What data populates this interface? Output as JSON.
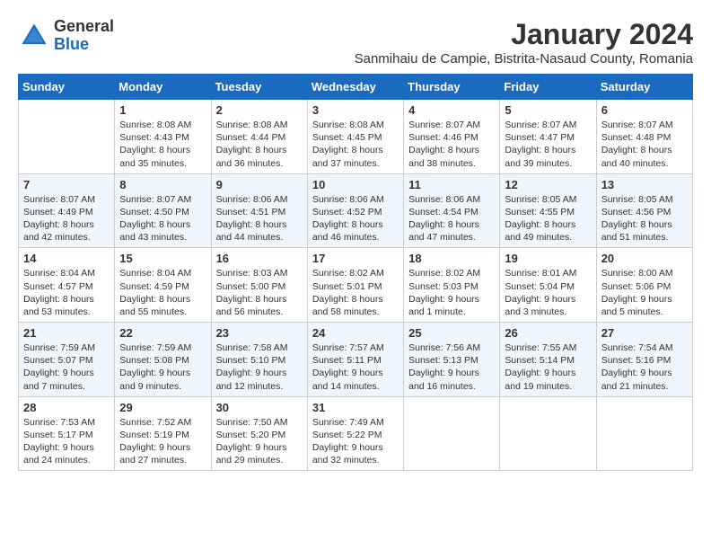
{
  "logo": {
    "general": "General",
    "blue": "Blue"
  },
  "title": "January 2024",
  "subtitle": "Sanmihaiu de Campie, Bistrita-Nasaud County, Romania",
  "days_of_week": [
    "Sunday",
    "Monday",
    "Tuesday",
    "Wednesday",
    "Thursday",
    "Friday",
    "Saturday"
  ],
  "weeks": [
    [
      {
        "day": "",
        "info": ""
      },
      {
        "day": "1",
        "info": "Sunrise: 8:08 AM\nSunset: 4:43 PM\nDaylight: 8 hours\nand 35 minutes."
      },
      {
        "day": "2",
        "info": "Sunrise: 8:08 AM\nSunset: 4:44 PM\nDaylight: 8 hours\nand 36 minutes."
      },
      {
        "day": "3",
        "info": "Sunrise: 8:08 AM\nSunset: 4:45 PM\nDaylight: 8 hours\nand 37 minutes."
      },
      {
        "day": "4",
        "info": "Sunrise: 8:07 AM\nSunset: 4:46 PM\nDaylight: 8 hours\nand 38 minutes."
      },
      {
        "day": "5",
        "info": "Sunrise: 8:07 AM\nSunset: 4:47 PM\nDaylight: 8 hours\nand 39 minutes."
      },
      {
        "day": "6",
        "info": "Sunrise: 8:07 AM\nSunset: 4:48 PM\nDaylight: 8 hours\nand 40 minutes."
      }
    ],
    [
      {
        "day": "7",
        "info": "Sunrise: 8:07 AM\nSunset: 4:49 PM\nDaylight: 8 hours\nand 42 minutes."
      },
      {
        "day": "8",
        "info": "Sunrise: 8:07 AM\nSunset: 4:50 PM\nDaylight: 8 hours\nand 43 minutes."
      },
      {
        "day": "9",
        "info": "Sunrise: 8:06 AM\nSunset: 4:51 PM\nDaylight: 8 hours\nand 44 minutes."
      },
      {
        "day": "10",
        "info": "Sunrise: 8:06 AM\nSunset: 4:52 PM\nDaylight: 8 hours\nand 46 minutes."
      },
      {
        "day": "11",
        "info": "Sunrise: 8:06 AM\nSunset: 4:54 PM\nDaylight: 8 hours\nand 47 minutes."
      },
      {
        "day": "12",
        "info": "Sunrise: 8:05 AM\nSunset: 4:55 PM\nDaylight: 8 hours\nand 49 minutes."
      },
      {
        "day": "13",
        "info": "Sunrise: 8:05 AM\nSunset: 4:56 PM\nDaylight: 8 hours\nand 51 minutes."
      }
    ],
    [
      {
        "day": "14",
        "info": "Sunrise: 8:04 AM\nSunset: 4:57 PM\nDaylight: 8 hours\nand 53 minutes."
      },
      {
        "day": "15",
        "info": "Sunrise: 8:04 AM\nSunset: 4:59 PM\nDaylight: 8 hours\nand 55 minutes."
      },
      {
        "day": "16",
        "info": "Sunrise: 8:03 AM\nSunset: 5:00 PM\nDaylight: 8 hours\nand 56 minutes."
      },
      {
        "day": "17",
        "info": "Sunrise: 8:02 AM\nSunset: 5:01 PM\nDaylight: 8 hours\nand 58 minutes."
      },
      {
        "day": "18",
        "info": "Sunrise: 8:02 AM\nSunset: 5:03 PM\nDaylight: 9 hours\nand 1 minute."
      },
      {
        "day": "19",
        "info": "Sunrise: 8:01 AM\nSunset: 5:04 PM\nDaylight: 9 hours\nand 3 minutes."
      },
      {
        "day": "20",
        "info": "Sunrise: 8:00 AM\nSunset: 5:06 PM\nDaylight: 9 hours\nand 5 minutes."
      }
    ],
    [
      {
        "day": "21",
        "info": "Sunrise: 7:59 AM\nSunset: 5:07 PM\nDaylight: 9 hours\nand 7 minutes."
      },
      {
        "day": "22",
        "info": "Sunrise: 7:59 AM\nSunset: 5:08 PM\nDaylight: 9 hours\nand 9 minutes."
      },
      {
        "day": "23",
        "info": "Sunrise: 7:58 AM\nSunset: 5:10 PM\nDaylight: 9 hours\nand 12 minutes."
      },
      {
        "day": "24",
        "info": "Sunrise: 7:57 AM\nSunset: 5:11 PM\nDaylight: 9 hours\nand 14 minutes."
      },
      {
        "day": "25",
        "info": "Sunrise: 7:56 AM\nSunset: 5:13 PM\nDaylight: 9 hours\nand 16 minutes."
      },
      {
        "day": "26",
        "info": "Sunrise: 7:55 AM\nSunset: 5:14 PM\nDaylight: 9 hours\nand 19 minutes."
      },
      {
        "day": "27",
        "info": "Sunrise: 7:54 AM\nSunset: 5:16 PM\nDaylight: 9 hours\nand 21 minutes."
      }
    ],
    [
      {
        "day": "28",
        "info": "Sunrise: 7:53 AM\nSunset: 5:17 PM\nDaylight: 9 hours\nand 24 minutes."
      },
      {
        "day": "29",
        "info": "Sunrise: 7:52 AM\nSunset: 5:19 PM\nDaylight: 9 hours\nand 27 minutes."
      },
      {
        "day": "30",
        "info": "Sunrise: 7:50 AM\nSunset: 5:20 PM\nDaylight: 9 hours\nand 29 minutes."
      },
      {
        "day": "31",
        "info": "Sunrise: 7:49 AM\nSunset: 5:22 PM\nDaylight: 9 hours\nand 32 minutes."
      },
      {
        "day": "",
        "info": ""
      },
      {
        "day": "",
        "info": ""
      },
      {
        "day": "",
        "info": ""
      }
    ]
  ]
}
